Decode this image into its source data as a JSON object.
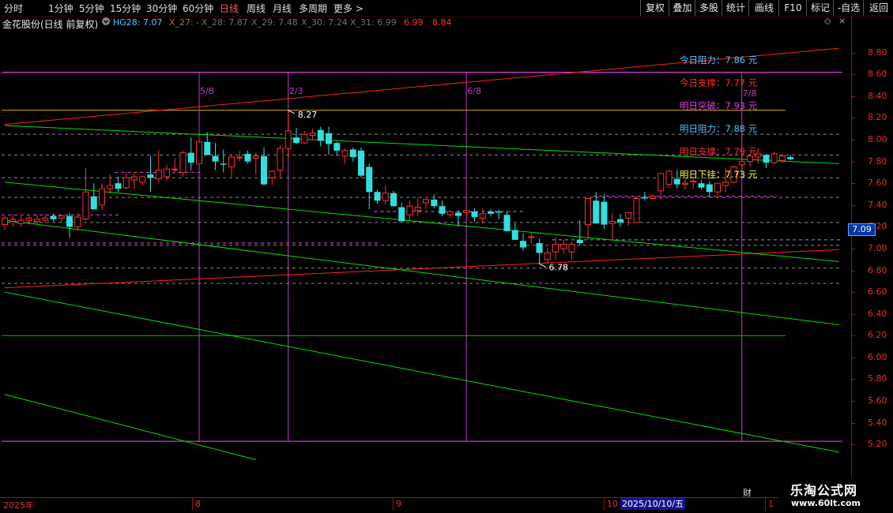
{
  "toolbar": {
    "periods": [
      "分时",
      "1分钟",
      "5分钟",
      "15分钟",
      "30分钟",
      "60分钟",
      "日线",
      "周线",
      "月线",
      "多周期",
      "更多 >"
    ],
    "active_period": "日线",
    "buttons": [
      "复权",
      "叠加",
      "多股",
      "统计",
      "画线",
      "F10",
      "标记",
      "-自选",
      "返回"
    ]
  },
  "stock": {
    "title": "金花股份(日线 前复权)",
    "settings_icon": "gear-circle-icon",
    "indicators": [
      {
        "label": "HG28: 7.07",
        "color": "#4fc3ff"
      },
      {
        "label": "X_27: -",
        "color": "#b07030"
      },
      {
        "label": "X_28: 7.87",
        "color": "#707070"
      },
      {
        "label": "X_29: 7.48",
        "color": "#707070"
      },
      {
        "label": "X_30: 7.24",
        "color": "#707070"
      },
      {
        "label": "X_31: 6.99",
        "color": "#707070"
      },
      {
        "label": "6.99",
        "color": "#ff3030"
      },
      {
        "label": "8.84",
        "color": "#ff3030"
      }
    ]
  },
  "annotations": [
    {
      "label": "今日阻力：",
      "value": "7.86 元",
      "color": "#4fc3ff"
    },
    {
      "label": "今日支撑：",
      "value": "7.77 元",
      "color": "#ff3030"
    },
    {
      "label": "明日突破：",
      "value": "7.93 元",
      "color": "#e040e0"
    },
    {
      "label": "明日阻力：",
      "value": "7.88 元",
      "color": "#4fc3ff"
    },
    {
      "label": "明日支撑：",
      "value": "7.79 元",
      "color": "#ff3030"
    },
    {
      "label": "明日下挂：",
      "value": "7.73 元",
      "color": "#ffff40"
    }
  ],
  "fib_labels": [
    "5/8",
    "2/3",
    "6/8",
    "7/8"
  ],
  "price_labels": {
    "high": "8.27",
    "low": "6.78"
  },
  "current_price": "7.09",
  "x_axis": {
    "labels": [
      "2025年",
      "8",
      "9",
      "10",
      "1"
    ],
    "date": "2025/10/10/五",
    "cai": "财"
  },
  "watermark": {
    "line1": "乐淘公式网",
    "line2": "www.60lt.com"
  },
  "chart_data": {
    "type": "candlestick",
    "ylim": [
      5.1,
      8.95
    ],
    "y_ticks": [
      "8.80",
      "8.60",
      "8.40",
      "8.20",
      "8.00",
      "7.80",
      "7.60",
      "7.40",
      "7.20",
      "7.00",
      "6.80",
      "6.60",
      "6.40",
      "6.20",
      "6.00",
      "5.80",
      "5.60",
      "5.40",
      "5.20"
    ],
    "candles": [
      [
        7.22,
        7.3,
        7.17,
        7.28
      ],
      [
        7.25,
        7.31,
        7.2,
        7.27
      ],
      [
        7.23,
        7.3,
        7.2,
        7.26
      ],
      [
        7.26,
        7.3,
        7.22,
        7.28
      ],
      [
        7.25,
        7.31,
        7.22,
        7.27
      ],
      [
        7.26,
        7.31,
        7.24,
        7.28
      ],
      [
        7.3,
        7.32,
        7.25,
        7.27
      ],
      [
        7.28,
        7.31,
        7.24,
        7.3
      ],
      [
        7.3,
        7.33,
        7.1,
        7.2
      ],
      [
        7.2,
        7.32,
        7.16,
        7.29
      ],
      [
        7.27,
        7.74,
        7.26,
        7.52
      ],
      [
        7.48,
        7.6,
        7.4,
        7.36
      ],
      [
        7.4,
        7.6,
        7.35,
        7.55
      ],
      [
        7.55,
        7.68,
        7.5,
        7.58
      ],
      [
        7.6,
        7.66,
        7.52,
        7.55
      ],
      [
        7.56,
        7.7,
        7.54,
        7.65
      ],
      [
        7.63,
        7.7,
        7.55,
        7.66
      ],
      [
        7.61,
        7.67,
        7.58,
        7.66
      ],
      [
        7.68,
        7.85,
        7.52,
        7.65
      ],
      [
        7.64,
        7.9,
        7.6,
        7.72
      ],
      [
        7.66,
        7.77,
        7.62,
        7.73
      ],
      [
        7.73,
        7.83,
        7.7,
        7.73
      ],
      [
        7.7,
        7.9,
        7.66,
        7.88
      ],
      [
        7.88,
        8.02,
        7.72,
        7.79
      ],
      [
        7.78,
        8.03,
        7.77,
        7.98
      ],
      [
        7.98,
        8.07,
        7.86,
        7.86
      ],
      [
        7.85,
        7.97,
        7.72,
        7.8
      ],
      [
        7.78,
        7.91,
        7.7,
        7.77
      ],
      [
        7.75,
        7.87,
        7.66,
        7.84
      ],
      [
        7.84,
        7.9,
        7.8,
        7.84
      ],
      [
        7.87,
        7.9,
        7.78,
        7.8
      ],
      [
        7.83,
        7.88,
        7.68,
        7.85
      ],
      [
        7.85,
        7.93,
        7.58,
        7.59
      ],
      [
        7.65,
        7.72,
        7.58,
        7.71
      ],
      [
        7.72,
        7.95,
        7.64,
        7.92
      ],
      [
        7.92,
        8.27,
        7.84,
        8.08
      ],
      [
        8.02,
        8.11,
        7.96,
        7.97
      ],
      [
        7.97,
        8.08,
        7.96,
        8.05
      ],
      [
        8.04,
        8.1,
        8.0,
        8.06
      ],
      [
        8.09,
        8.12,
        7.94,
        7.99
      ],
      [
        8.06,
        8.12,
        7.86,
        7.96
      ],
      [
        7.97,
        7.98,
        7.85,
        7.9
      ],
      [
        7.85,
        7.92,
        7.78,
        7.9
      ],
      [
        7.91,
        7.93,
        7.8,
        7.84
      ],
      [
        7.9,
        7.93,
        7.65,
        7.67
      ],
      [
        7.75,
        7.78,
        7.36,
        7.52
      ],
      [
        7.52,
        7.54,
        7.41,
        7.44
      ],
      [
        7.44,
        7.58,
        7.4,
        7.51
      ],
      [
        7.51,
        7.53,
        7.38,
        7.39
      ],
      [
        7.38,
        7.42,
        7.25,
        7.25
      ],
      [
        7.31,
        7.44,
        7.25,
        7.39
      ],
      [
        7.35,
        7.47,
        7.3,
        7.38
      ],
      [
        7.42,
        7.46,
        7.36,
        7.45
      ],
      [
        7.45,
        7.5,
        7.37,
        7.39
      ],
      [
        7.39,
        7.44,
        7.3,
        7.32
      ],
      [
        7.31,
        7.35,
        7.28,
        7.34
      ],
      [
        7.33,
        7.35,
        7.2,
        7.3
      ],
      [
        7.33,
        7.36,
        7.3,
        7.35
      ],
      [
        7.34,
        7.37,
        7.25,
        7.29
      ],
      [
        7.28,
        7.37,
        7.23,
        7.32
      ],
      [
        7.34,
        7.36,
        7.3,
        7.32
      ],
      [
        7.34,
        7.36,
        7.27,
        7.33
      ],
      [
        7.31,
        7.34,
        7.16,
        7.16
      ],
      [
        7.17,
        7.23,
        7.1,
        7.08
      ],
      [
        7.07,
        7.14,
        6.98,
        7.01
      ],
      [
        7.1,
        7.15,
        7.04,
        7.11
      ],
      [
        7.05,
        7.09,
        6.86,
        6.96
      ],
      [
        6.9,
        7.01,
        6.87,
        6.96
      ],
      [
        6.97,
        7.1,
        6.9,
        7.04
      ],
      [
        7.0,
        7.08,
        6.95,
        7.04
      ],
      [
        6.97,
        7.06,
        6.9,
        7.04
      ],
      [
        7.08,
        7.26,
        7.03,
        7.05
      ],
      [
        7.22,
        7.47,
        7.08,
        7.46
      ],
      [
        7.44,
        7.52,
        7.41,
        7.23
      ],
      [
        7.43,
        7.5,
        7.18,
        7.22
      ],
      [
        7.23,
        7.33,
        7.08,
        7.25
      ],
      [
        7.27,
        7.32,
        7.2,
        7.24
      ],
      [
        7.28,
        7.33,
        7.21,
        7.33
      ],
      [
        7.24,
        7.48,
        7.24,
        7.46
      ],
      [
        7.47,
        7.52,
        7.44,
        7.46
      ],
      [
        7.46,
        7.5,
        7.45,
        7.48
      ],
      [
        7.53,
        7.67,
        7.45,
        7.69
      ],
      [
        7.59,
        7.72,
        7.56,
        7.71
      ],
      [
        7.64,
        7.72,
        7.55,
        7.59
      ],
      [
        7.59,
        7.65,
        7.54,
        7.6
      ],
      [
        7.62,
        7.64,
        7.55,
        7.62
      ],
      [
        7.6,
        7.63,
        7.54,
        7.56
      ],
      [
        7.59,
        7.62,
        7.47,
        7.52
      ],
      [
        7.52,
        7.6,
        7.47,
        7.6
      ],
      [
        7.58,
        7.74,
        7.52,
        7.61
      ],
      [
        7.61,
        7.76,
        7.6,
        7.75
      ],
      [
        7.77,
        7.87,
        7.72,
        7.8
      ],
      [
        7.8,
        7.87,
        7.75,
        7.85
      ],
      [
        7.84,
        7.92,
        7.78,
        7.87
      ],
      [
        7.86,
        7.87,
        7.74,
        7.79
      ],
      [
        7.79,
        7.89,
        7.78,
        7.87
      ],
      [
        7.81,
        7.87,
        7.79,
        7.85
      ],
      [
        7.84,
        7.86,
        7.81,
        7.82
      ]
    ],
    "trend_lines": [
      {
        "color": "#ff2020",
        "from": [
          0,
          8.14
        ],
        "to": [
          103,
          8.84
        ]
      },
      {
        "color": "#ff2020",
        "from": [
          0,
          6.64
        ],
        "to": [
          103,
          6.99
        ]
      },
      {
        "color": "#00e000",
        "from": [
          0,
          8.13
        ],
        "to": [
          103,
          7.78
        ]
      },
      {
        "color": "#00e000",
        "from": [
          0,
          7.61
        ],
        "to": [
          103,
          6.88
        ]
      },
      {
        "color": "#00e000",
        "from": [
          0,
          7.26
        ],
        "to": [
          103,
          6.3
        ]
      },
      {
        "color": "#00e000",
        "from": [
          0,
          6.6
        ],
        "to": [
          103,
          5.13
        ]
      },
      {
        "color": "#00e000",
        "from": [
          0,
          5.66
        ],
        "to": [
          31,
          5.06
        ]
      }
    ],
    "horizontal_lines": [
      {
        "y": 8.62,
        "color": "#ff40ff",
        "from": 0,
        "to": 103
      },
      {
        "y": 8.27,
        "color": "#d8b020",
        "from": 0,
        "to": 96
      },
      {
        "y": 8.05,
        "color": "#888888",
        "from": 0,
        "to": 103,
        "dashed": true
      },
      {
        "y": 7.86,
        "color": "#888888",
        "from": 0,
        "to": 103,
        "dashed": true
      },
      {
        "y": 7.65,
        "color": "#888888",
        "from": 0,
        "to": 103,
        "dashed": true
      },
      {
        "y": 7.47,
        "color": "#888888",
        "from": 0,
        "to": 103,
        "dashed": true
      },
      {
        "y": 7.24,
        "color": "#888888",
        "from": 0,
        "to": 103,
        "dashed": true
      },
      {
        "y": 7.03,
        "color": "#888888",
        "from": 0,
        "to": 103,
        "dashed": true
      },
      {
        "y": 6.82,
        "color": "#888888",
        "from": 0,
        "to": 103,
        "dashed": true
      },
      {
        "y": 6.68,
        "color": "#888888",
        "from": 0,
        "to": 103,
        "dashed": true
      },
      {
        "y": 6.2,
        "color": "#00c000",
        "from": 0,
        "to": 96
      },
      {
        "y": 5.23,
        "color": "#ff40ff",
        "from": 0,
        "to": 103
      },
      {
        "y": 7.31,
        "color": "#ff40ff",
        "from": 0,
        "to": 14,
        "dashed": true
      },
      {
        "y": 7.7,
        "color": "#ff40ff",
        "from": 14,
        "to": 24,
        "dashed": true
      },
      {
        "y": 7.05,
        "color": "#ff40ff",
        "from": 0,
        "to": 46,
        "dashed": true
      },
      {
        "y": 7.34,
        "color": "#9090ff",
        "from": 46,
        "to": 64,
        "dashed": true
      },
      {
        "y": 7.08,
        "color": "#9090ff",
        "from": 68,
        "to": 103,
        "dashed": true
      },
      {
        "y": 7.48,
        "color": "#ff40ff",
        "from": 73,
        "to": 95,
        "dashed": true
      }
    ],
    "vertical_lines": [
      24,
      35,
      57,
      91
    ]
  }
}
